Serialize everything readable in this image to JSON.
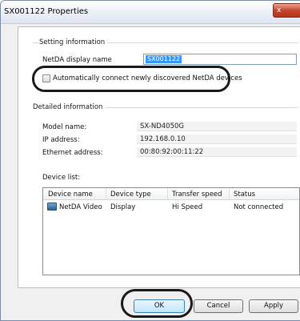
{
  "window": {
    "title": "SX001122 Properties",
    "close_label": "x"
  },
  "setting": {
    "group_title": "Setting information",
    "display_name_label": "NetDA display name",
    "display_name_value": "SX001122",
    "auto_connect_label": "Automatically connect newly discovered NetDA devices"
  },
  "detailed": {
    "group_title": "Detailed information",
    "model_label": "Model name:",
    "model_value": "SX-ND4050G",
    "ip_label": "IP address:",
    "ip_value": "192.168.0.10",
    "mac_label": "Ethernet address:",
    "mac_value": "00:80:92:00:11:22",
    "device_list_label": "Device list:"
  },
  "device_list": {
    "columns": [
      "Device name",
      "Device type",
      "Transfer speed",
      "Status"
    ],
    "rows": [
      {
        "name": "NetDA Video",
        "type": "Display",
        "speed": "Hi Speed",
        "status": "Not connected"
      }
    ]
  },
  "buttons": {
    "ok": "OK",
    "cancel": "Cancel",
    "apply": "Apply"
  }
}
